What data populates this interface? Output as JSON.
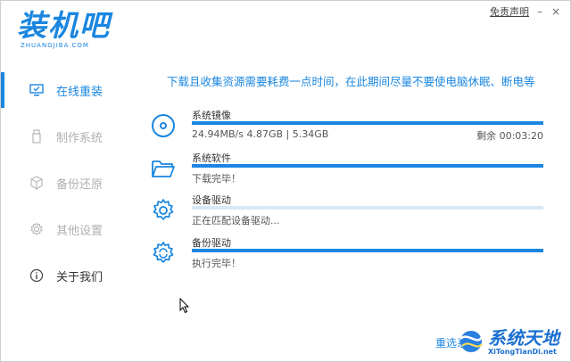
{
  "header": {
    "logo_title": "装机吧",
    "logo_subtitle": "ZHUANGJIBA.COM",
    "disclaimer": "免责声明",
    "minimize": "–",
    "close": "×"
  },
  "sidebar": {
    "items": [
      {
        "label": "在线重装",
        "icon": "monitor-icon",
        "state": "active"
      },
      {
        "label": "制作系统",
        "icon": "usb-icon",
        "state": "disabled"
      },
      {
        "label": "备份还原",
        "icon": "cube-icon",
        "state": "disabled"
      },
      {
        "label": "其他设置",
        "icon": "gear-icon",
        "state": "disabled"
      },
      {
        "label": "关于我们",
        "icon": "info-icon",
        "state": "normal"
      }
    ]
  },
  "notice": "下载且收集资源需要耗费一点时间，在此期间尽量不要使电脑休眠、断电等",
  "tasks": [
    {
      "name": "系统镜像",
      "icon": "disc-icon",
      "progress": 1.0,
      "status": "24.94MB/s 4.87GB | 5.34GB",
      "remaining": "剩余 00:03:20"
    },
    {
      "name": "系统软件",
      "icon": "folder-icon",
      "progress": 1.0,
      "status": "下载完毕！",
      "remaining": ""
    },
    {
      "name": "设备驱动",
      "icon": "gear-icon",
      "progress": 0.0,
      "status": "正在匹配设备驱动...",
      "remaining": ""
    },
    {
      "name": "备份驱动",
      "icon": "gear-refresh-icon",
      "progress": 1.0,
      "status": "执行完毕！",
      "remaining": ""
    }
  ],
  "reselect": "重选系",
  "watermark": {
    "title": "系统天地",
    "subtitle": "XiTongTianDi.net"
  },
  "colors": {
    "accent": "#1a86e0",
    "track": "#d8e8f6"
  }
}
